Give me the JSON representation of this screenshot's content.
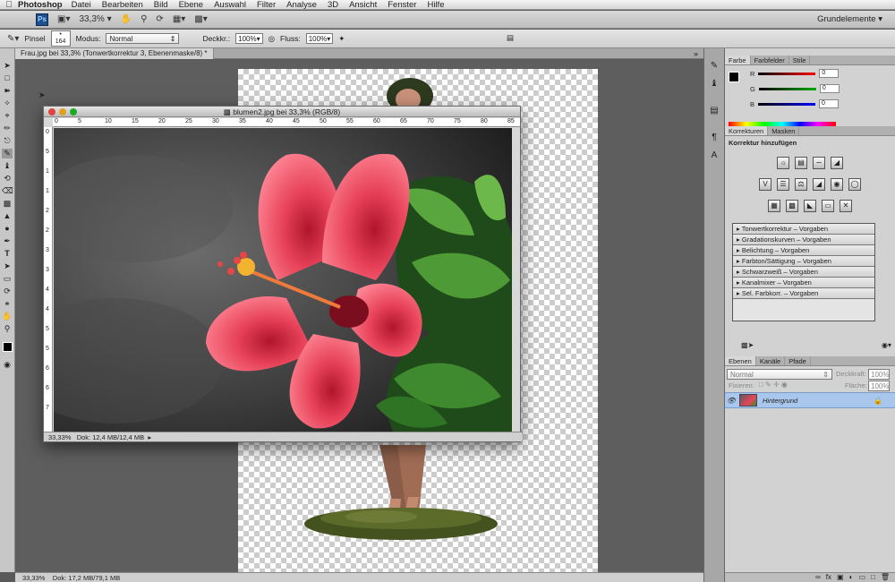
{
  "menubar": {
    "app_name": "Photoshop",
    "items": [
      "Datei",
      "Bearbeiten",
      "Bild",
      "Ebene",
      "Auswahl",
      "Filter",
      "Analyse",
      "3D",
      "Ansicht",
      "Fenster",
      "Hilfe"
    ]
  },
  "appbar": {
    "logo": "Ps",
    "zoom": "33,3%",
    "workspace": "Grundelemente"
  },
  "options": {
    "brush_label": "Pinsel",
    "brush_size": "164",
    "mode_label": "Modus:",
    "mode_value": "Normal",
    "opacity_label": "Deckkr.:",
    "opacity_value": "100%",
    "flow_label": "Fluss:",
    "flow_value": "100%"
  },
  "document": {
    "tab_title": "Frau.jpg bei 33,3% (Tonwertkorrektur 3, Ebenenmaske/8) *",
    "status_zoom": "33,33%",
    "status_doc": "Dok: 17,2 MB/79,1 MB"
  },
  "floating": {
    "title": "blumen2.jpg bei 33,3% (RGB/8)",
    "status_zoom": "33,33%",
    "status_doc": "Dok: 12,4 MB/12,4 MB",
    "ruler_top": [
      "0",
      "5",
      "10",
      "15",
      "20",
      "25",
      "30",
      "35",
      "40",
      "45",
      "50",
      "55",
      "60",
      "65",
      "70",
      "75",
      "80",
      "85"
    ],
    "ruler_left": [
      "0",
      "5",
      "1",
      "1",
      "2",
      "2",
      "3",
      "3",
      "4",
      "4",
      "5",
      "5",
      "6",
      "6",
      "7"
    ]
  },
  "color_panel": {
    "tabs": [
      "Farbe",
      "Farbfelder",
      "Stile"
    ],
    "r_label": "R",
    "r_value": "0",
    "g_label": "G",
    "g_value": "0",
    "b_label": "B",
    "b_value": "0"
  },
  "adjustments_panel": {
    "tabs": [
      "Korrekturen",
      "Masken"
    ],
    "header": "Korrektur hinzufügen",
    "presets": [
      "Tonwertkorrektur – Vorgaben",
      "Gradationskurven – Vorgaben",
      "Belichtung – Vorgaben",
      "Farbton/Sättigung – Vorgaben",
      "Schwarzweiß – Vorgaben",
      "Kanalmixer – Vorgaben",
      "Sel. Farbkorr. – Vorgaben"
    ]
  },
  "layers_panel": {
    "tabs": [
      "Ebenen",
      "Kanäle",
      "Pfade"
    ],
    "blend_mode": "Normal",
    "opacity_label": "Deckkraft:",
    "opacity_value": "100%",
    "lock_label": "Fixieren:",
    "fill_label": "Fläche:",
    "fill_value": "100%",
    "layer_name": "Hintergrund"
  },
  "colors": {
    "accent_selection": "#a9c6ec",
    "flower": "#e8435a"
  }
}
